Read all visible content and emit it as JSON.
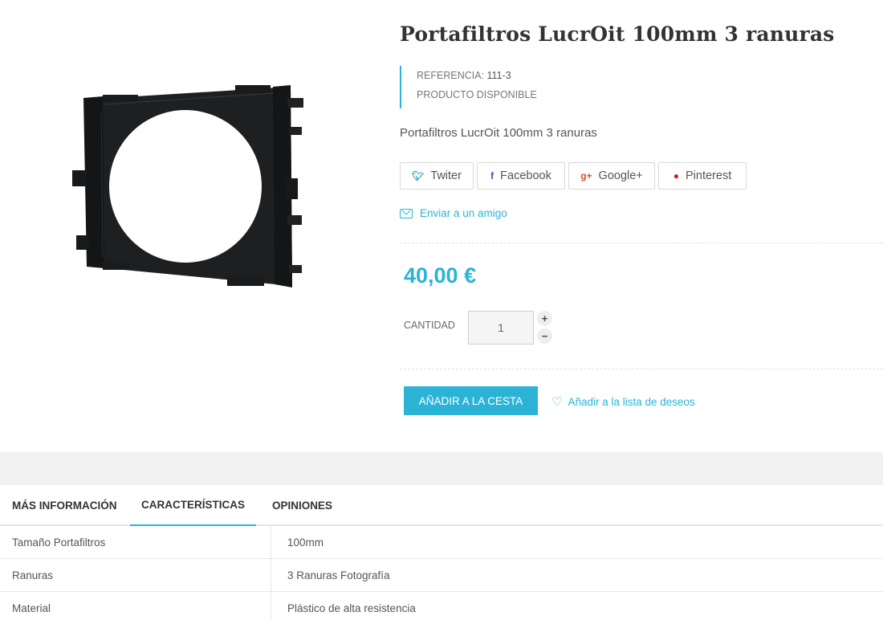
{
  "product": {
    "title": "Portafiltros LucrOit 100mm 3 ranuras",
    "reference_label": "REFERENCIA:",
    "reference_value": "111-3",
    "availability": "PRODUCTO DISPONIBLE",
    "short_description": "Portafiltros LucrOit 100mm 3 ranuras",
    "price": "40,00 €",
    "image_icon": "filter-holder-product-photo"
  },
  "share": {
    "buttons": [
      {
        "label": "Twiter",
        "icon": "twitter-icon"
      },
      {
        "label": "Facebook",
        "icon": "facebook-icon"
      },
      {
        "label": "Google+",
        "icon": "google-plus-icon"
      },
      {
        "label": "Pinterest",
        "icon": "pinterest-icon"
      }
    ],
    "send_friend": "Enviar a un amigo"
  },
  "quantity": {
    "label": "CANTIDAD",
    "value": "1",
    "plus": "+",
    "minus": "−"
  },
  "actions": {
    "add_to_cart": "AÑADIR A LA CESTA",
    "wishlist": "Añadir a la lista de deseos"
  },
  "tabs": [
    {
      "label": "MÁS INFORMACIÓN",
      "active": false
    },
    {
      "label": "CARACTERÍSTICAS",
      "active": true
    },
    {
      "label": "OPINIONES",
      "active": false
    }
  ],
  "features": [
    {
      "name": "Tamaño Portafiltros",
      "value": "100mm"
    },
    {
      "name": "Ranuras",
      "value": "3 Ranuras Fotografía"
    },
    {
      "name": "Material",
      "value": "Plástico de alta resistencia"
    }
  ],
  "colors": {
    "accent": "#2bb3d6",
    "twitter": "#2d9bd8",
    "facebook": "#3b5998",
    "google": "#dd4b39",
    "pinterest": "#cb2027"
  }
}
